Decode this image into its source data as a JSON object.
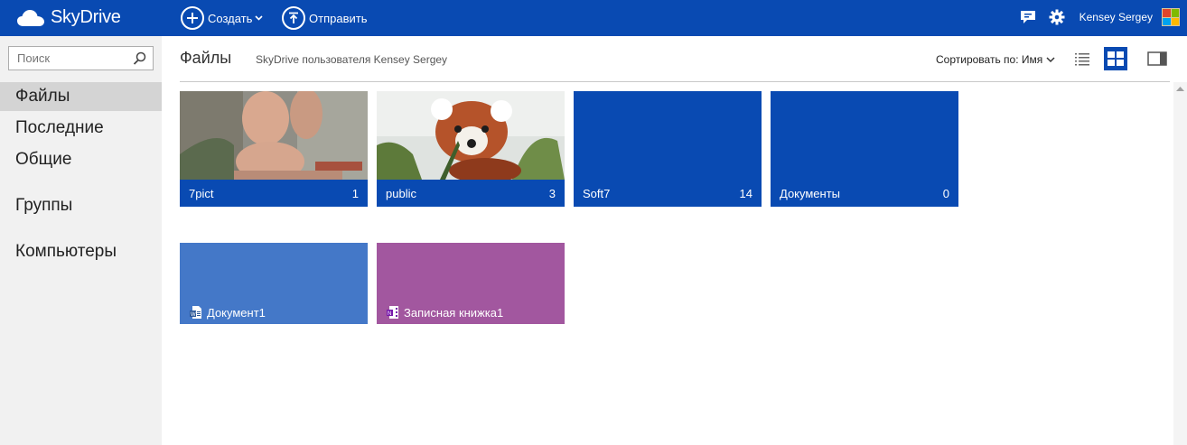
{
  "app": {
    "brand": "SkyDrive",
    "create_label": "Создать",
    "upload_label": "Отправить",
    "user_name": "Kensey Sergey",
    "colors": {
      "accent": "#094ab2",
      "word_tile": "#4478c8",
      "onenote_tile": "#a2579f",
      "sidebar_bg": "#f1f1f1",
      "sidebar_active": "#d4d4d4"
    }
  },
  "search": {
    "placeholder": "Поиск",
    "icon": "search-icon"
  },
  "sidebar": {
    "items": [
      {
        "label": "Файлы",
        "active": true
      },
      {
        "label": "Последние",
        "active": false
      },
      {
        "label": "Общие",
        "active": false
      },
      {
        "label": "Группы",
        "active": false
      },
      {
        "label": "Компьютеры",
        "active": false
      }
    ]
  },
  "header": {
    "title": "Файлы",
    "subtitle": "SkyDrive пользователя Kensey Sergey",
    "sort_label": "Сортировать по: Имя"
  },
  "folders": [
    {
      "name": "7pict",
      "count": "1",
      "thumb": "photo"
    },
    {
      "name": "public",
      "count": "3",
      "thumb": "red-panda"
    },
    {
      "name": "Soft7",
      "count": "14",
      "thumb": "none"
    },
    {
      "name": "Документы",
      "count": "0",
      "thumb": "none"
    }
  ],
  "documents": [
    {
      "name": "Документ1",
      "icon": "word-doc-icon"
    },
    {
      "name": "Записная книжка1",
      "icon": "onenote-icon"
    }
  ]
}
